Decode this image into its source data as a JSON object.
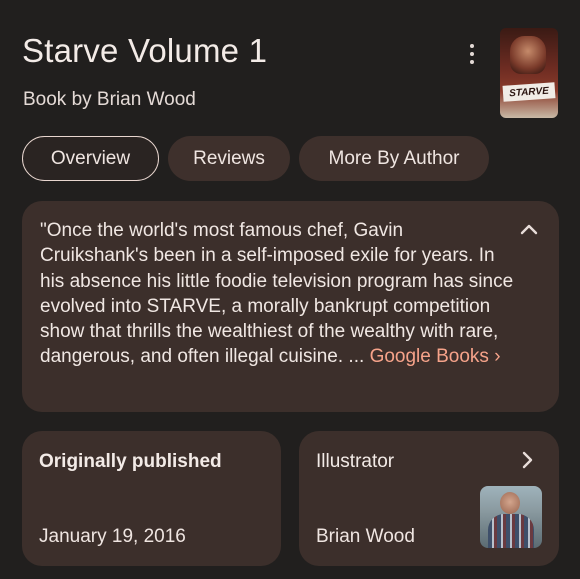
{
  "book": {
    "title": "Starve Volume 1",
    "subtitle": "Book by Brian Wood",
    "cover_text": "STARVE"
  },
  "tabs": [
    {
      "label": "Overview",
      "active": true
    },
    {
      "label": "Reviews",
      "active": false
    },
    {
      "label": "More By Author",
      "active": false
    }
  ],
  "description": {
    "text": "\"Once the world's most famous chef, Gavin Cruikshank's been in a self-imposed exile for years. In his absence his little foodie television program has since evolved into STARVE, a morally bankrupt competition show that thrills the wealthiest of the wealthy with rare, dangerous, and often illegal cuisine. ... ",
    "source_link": "Google Books ›"
  },
  "info_cards": {
    "published": {
      "heading": "Originally published",
      "value": "January 19, 2016"
    },
    "illustrator": {
      "heading": "Illustrator",
      "value": "Brian Wood"
    }
  },
  "icons": {
    "more": "more-vert-icon",
    "collapse": "chevron-up-icon",
    "open": "chevron-right-icon"
  },
  "colors": {
    "background": "#211f1e",
    "card": "#3c2f2b",
    "link": "#f6a38a",
    "active_tab_border": "#e8d6cf"
  }
}
